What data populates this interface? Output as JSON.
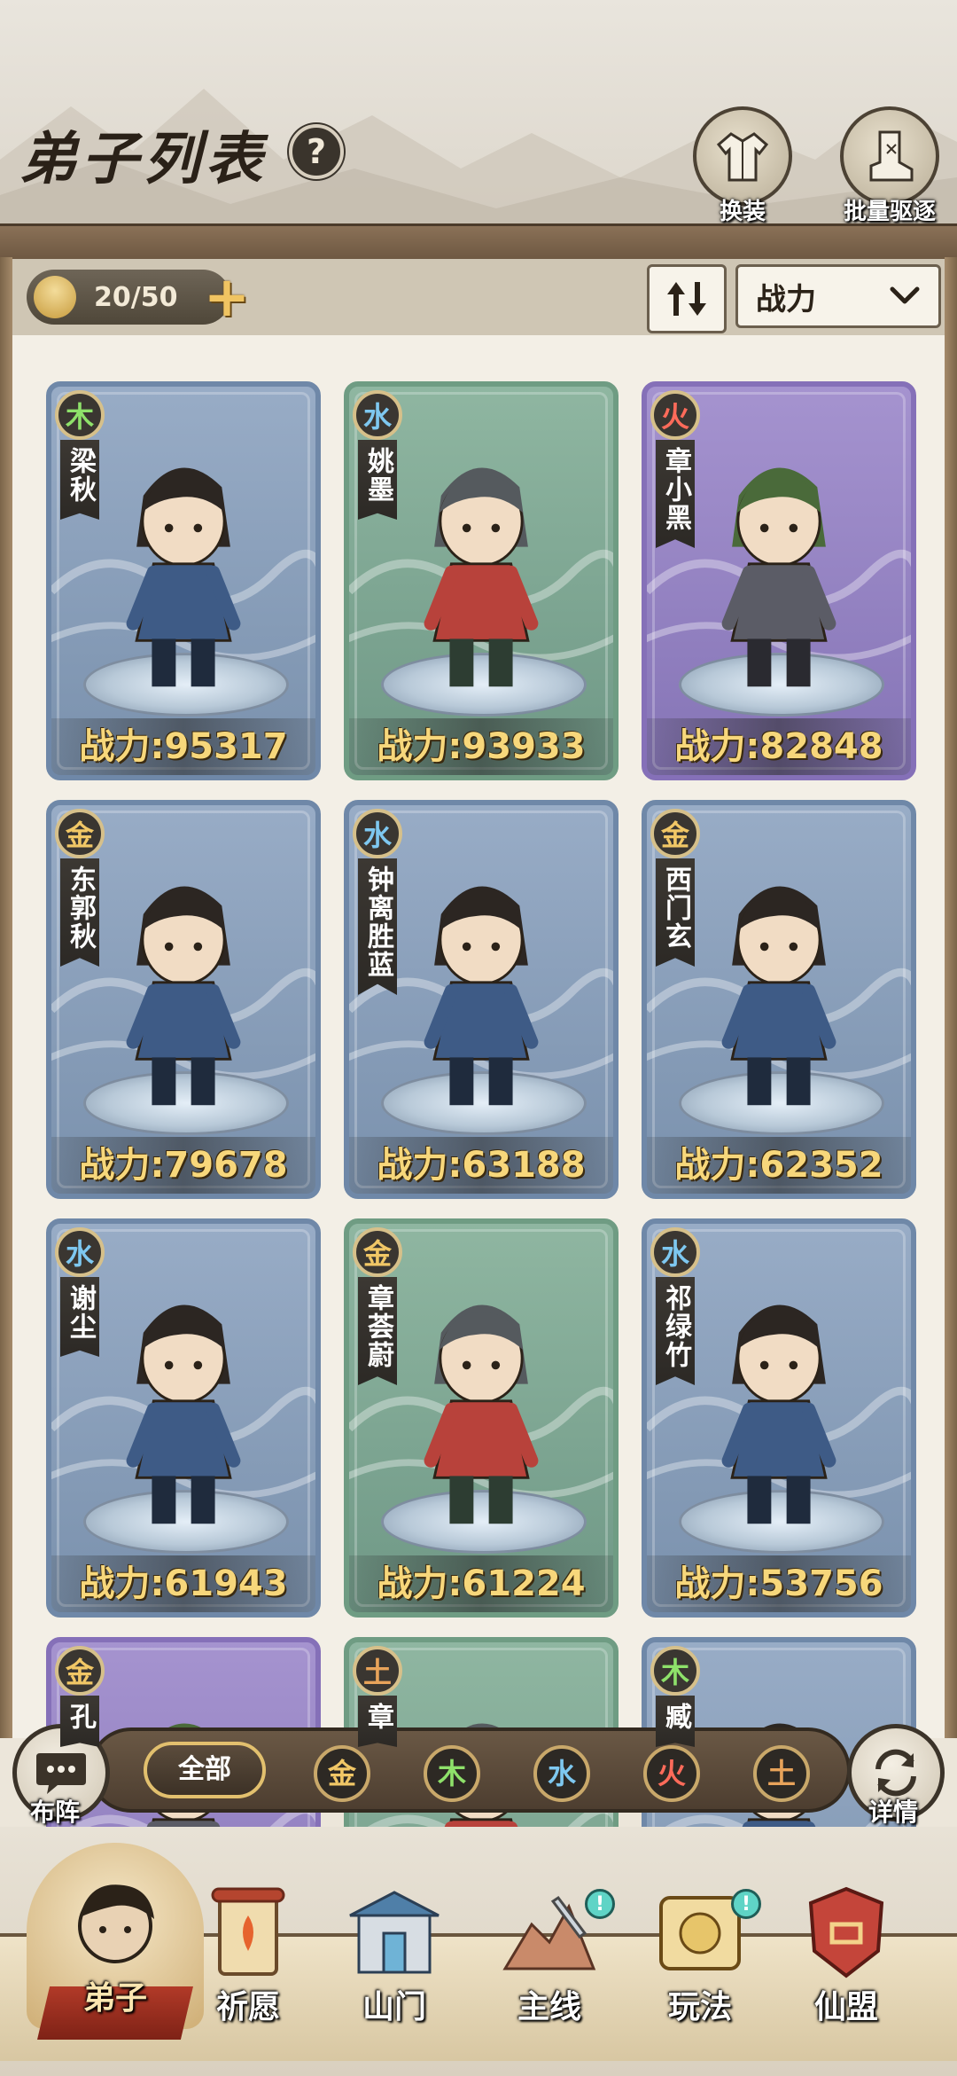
{
  "header": {
    "title": "弟子列表",
    "help_label": "?",
    "buttons": [
      {
        "label": "换装",
        "icon": "robe-icon"
      },
      {
        "label": "批量驱逐",
        "icon": "boot-icon"
      }
    ]
  },
  "toolbar": {
    "disciple_count": "20/50",
    "add_label": "+",
    "sort_field": "战力"
  },
  "disciples": [
    {
      "element": "木",
      "element_type": "wood",
      "name": "梁秋",
      "power": "战力:95317",
      "frame": "blue"
    },
    {
      "element": "水",
      "element_type": "water",
      "name": "姚墨",
      "power": "战力:93933",
      "frame": "green"
    },
    {
      "element": "火",
      "element_type": "fire",
      "name": "章小黑",
      "power": "战力:82848",
      "frame": "purple"
    },
    {
      "element": "金",
      "element_type": "gold",
      "name": "东郭秋",
      "power": "战力:79678",
      "frame": "blue"
    },
    {
      "element": "水",
      "element_type": "water",
      "name": "钟离胜蓝",
      "power": "战力:63188",
      "frame": "blue"
    },
    {
      "element": "金",
      "element_type": "gold",
      "name": "西门玄",
      "power": "战力:62352",
      "frame": "blue"
    },
    {
      "element": "水",
      "element_type": "water",
      "name": "谢尘",
      "power": "战力:61943",
      "frame": "blue"
    },
    {
      "element": "金",
      "element_type": "gold",
      "name": "章荟蔚",
      "power": "战力:61224",
      "frame": "green"
    },
    {
      "element": "水",
      "element_type": "water",
      "name": "祁绿竹",
      "power": "战力:53756",
      "frame": "blue"
    },
    {
      "element": "金",
      "element_type": "gold",
      "name": "孔",
      "power": "",
      "frame": "purple"
    },
    {
      "element": "土",
      "element_type": "earth",
      "name": "章",
      "power": "",
      "frame": "green"
    },
    {
      "element": "木",
      "element_type": "wood",
      "name": "臧",
      "power": "",
      "frame": "blue"
    }
  ],
  "filter": {
    "formation_label": "布阵",
    "all_label": "全部",
    "elements": [
      "金",
      "木",
      "水",
      "火",
      "土"
    ],
    "details_label": "详情"
  },
  "nav": [
    {
      "label": "弟子",
      "icon": "disciple-icon",
      "active": true
    },
    {
      "label": "祈愿",
      "icon": "scroll-icon",
      "active": false
    },
    {
      "label": "山门",
      "icon": "gate-icon",
      "active": false
    },
    {
      "label": "主线",
      "icon": "mainline-icon",
      "active": false,
      "badge": "!"
    },
    {
      "label": "玩法",
      "icon": "gameplay-icon",
      "active": false,
      "badge": "!"
    },
    {
      "label": "仙盟",
      "icon": "alliance-icon",
      "active": false
    }
  ],
  "colors": {
    "wood": "#8ee16a",
    "water": "#7ec8f0",
    "fire": "#ff6b5a",
    "gold": "#f1c766",
    "earth": "#e8a35a",
    "power_text": "#f7d77b"
  }
}
